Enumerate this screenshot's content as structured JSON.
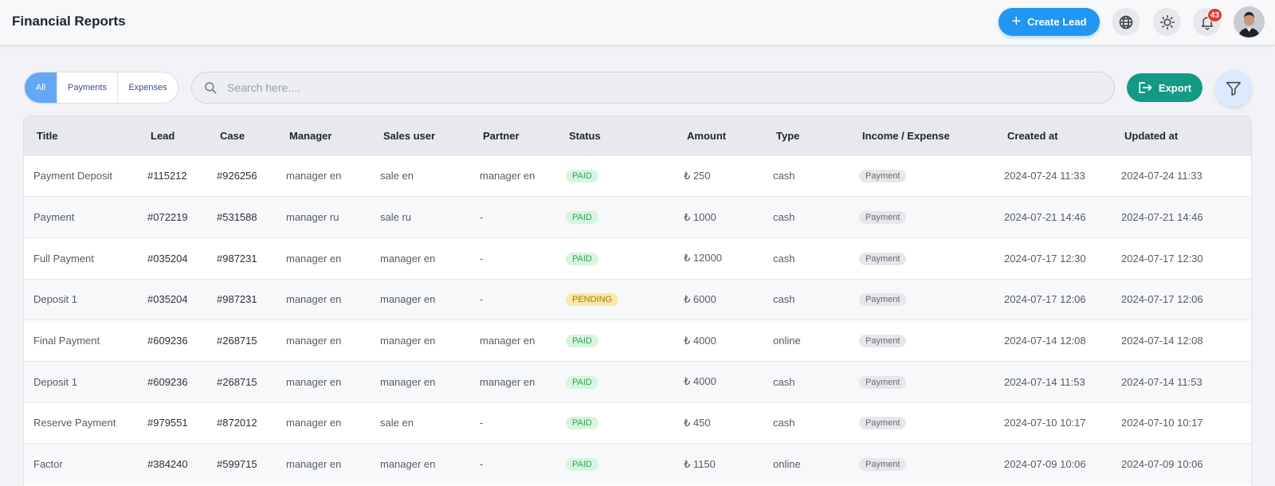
{
  "header": {
    "title": "Financial Reports",
    "create_label": "Create Lead",
    "notifications_count": "43"
  },
  "filters": {
    "segments": [
      "All",
      "Payments",
      "Expenses"
    ],
    "search_placeholder": "Search here....",
    "export_label": "Export"
  },
  "table": {
    "columns": [
      "Title",
      "Lead",
      "Case",
      "Manager",
      "Sales user",
      "Partner",
      "Status",
      "Amount",
      "Type",
      "Income / Expense",
      "Created at",
      "Updated at"
    ],
    "rows": [
      {
        "title": "Payment Deposit",
        "lead": "#115212",
        "case": "#926256",
        "manager": "manager en",
        "sales_user": "sale en",
        "partner": "manager en",
        "status": "PAID",
        "amount": "₺ 250",
        "type": "cash",
        "kind": "Payment",
        "created": "2024-07-24 11:33",
        "updated": "2024-07-24 11:33"
      },
      {
        "title": "Payment",
        "lead": "#072219",
        "case": "#531588",
        "manager": "manager ru",
        "sales_user": "sale ru",
        "partner": "-",
        "status": "PAID",
        "amount": "₺ 1000",
        "type": "cash",
        "kind": "Payment",
        "created": "2024-07-21 14:46",
        "updated": "2024-07-21 14:46"
      },
      {
        "title": "Full Payment",
        "lead": "#035204",
        "case": "#987231",
        "manager": "manager en",
        "sales_user": "manager en",
        "partner": "-",
        "status": "PAID",
        "amount": "₺ 12000",
        "type": "cash",
        "kind": "Payment",
        "created": "2024-07-17 12:30",
        "updated": "2024-07-17 12:30"
      },
      {
        "title": "Deposit 1",
        "lead": "#035204",
        "case": "#987231",
        "manager": "manager en",
        "sales_user": "manager en",
        "partner": "-",
        "status": "PENDING",
        "amount": "₺ 6000",
        "type": "cash",
        "kind": "Payment",
        "created": "2024-07-17 12:06",
        "updated": "2024-07-17 12:06"
      },
      {
        "title": "Final Payment",
        "lead": "#609236",
        "case": "#268715",
        "manager": "manager en",
        "sales_user": "manager en",
        "partner": "manager en",
        "status": "PAID",
        "amount": "₺ 4000",
        "type": "online",
        "kind": "Payment",
        "created": "2024-07-14 12:08",
        "updated": "2024-07-14 12:08"
      },
      {
        "title": "Deposit 1",
        "lead": "#609236",
        "case": "#268715",
        "manager": "manager en",
        "sales_user": "manager en",
        "partner": "manager en",
        "status": "PAID",
        "amount": "₺ 4000",
        "type": "cash",
        "kind": "Payment",
        "created": "2024-07-14 11:53",
        "updated": "2024-07-14 11:53"
      },
      {
        "title": "Reserve Payment",
        "lead": "#979551",
        "case": "#872012",
        "manager": "manager en",
        "sales_user": "sale en",
        "partner": "-",
        "status": "PAID",
        "amount": "₺ 450",
        "type": "cash",
        "kind": "Payment",
        "created": "2024-07-10 10:17",
        "updated": "2024-07-10 10:17"
      },
      {
        "title": "Factor",
        "lead": "#384240",
        "case": "#599715",
        "manager": "manager en",
        "sales_user": "manager en",
        "partner": "-",
        "status": "PAID",
        "amount": "₺ 1150",
        "type": "online",
        "kind": "Payment",
        "created": "2024-07-09 10:06",
        "updated": "2024-07-09 10:06"
      }
    ]
  },
  "icons": {
    "language": "globe-icon",
    "theme": "sun-icon",
    "notifications": "bell-icon",
    "search": "search-icon",
    "export": "export-icon",
    "filter": "filter-icon"
  },
  "colors": {
    "primary": "#2196f3",
    "export": "#139a85",
    "paid": "#2fa356",
    "pending": "#a07a10",
    "badge": "#e53935"
  }
}
